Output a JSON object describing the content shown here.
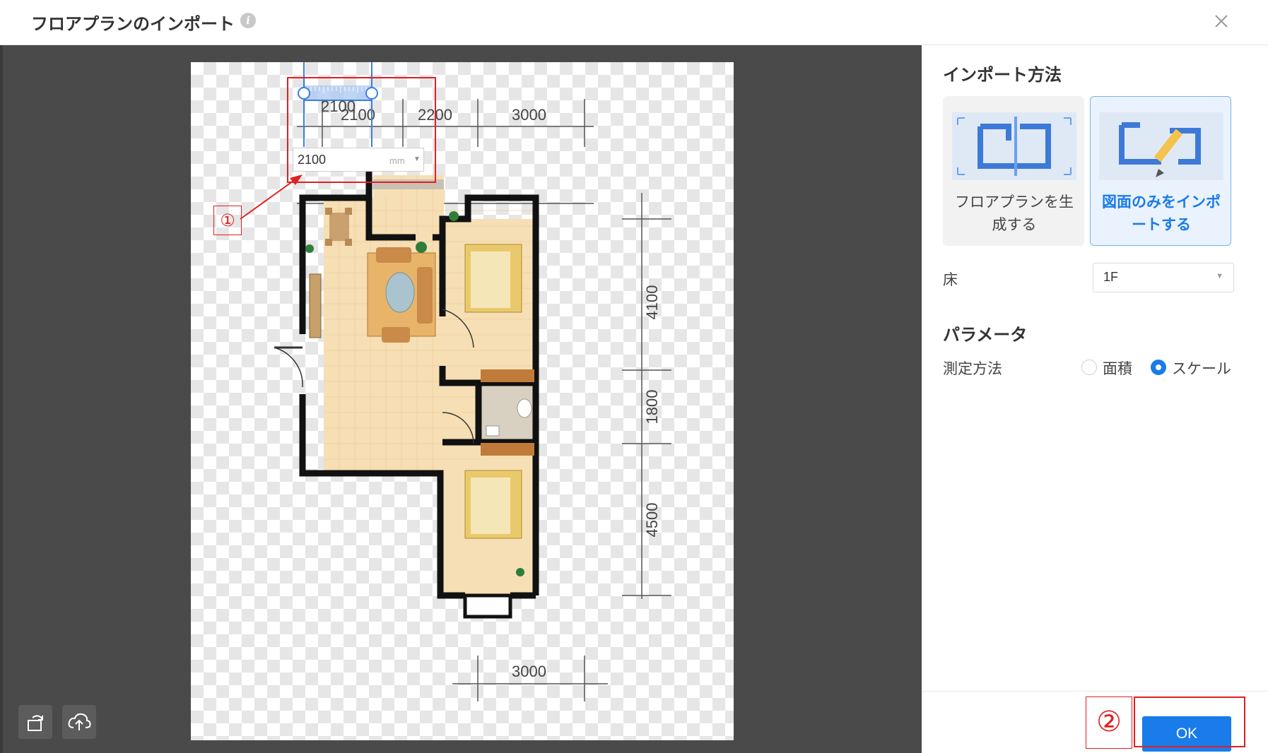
{
  "dialog": {
    "title": "フロアプランのインポート",
    "info_icon_glyph": "i",
    "close_icon": "close-icon"
  },
  "canvas": {
    "tools": [
      {
        "name": "rotate-icon"
      },
      {
        "name": "upload-icon"
      }
    ],
    "dimensions": {
      "top": [
        "2100",
        "2200",
        "3000"
      ],
      "right": [
        "4100",
        "1800",
        "4500"
      ],
      "bottom": "3000"
    },
    "scale_input": {
      "value": "2100",
      "unit": "mm",
      "ruler_label": "2100"
    }
  },
  "annotations": {
    "marker_1": "①",
    "marker_2": "②",
    "color": "#e02020"
  },
  "panel": {
    "import_method_title": "インポート方法",
    "cards": [
      {
        "line1": "フロアプランを生",
        "line2": "成する",
        "selected": false
      },
      {
        "line1": "図面のみをインポ",
        "line2": "ートする",
        "selected": true
      }
    ],
    "floor_label": "床",
    "floor_value": "1F",
    "params_title": "パラメータ",
    "measure_label": "測定方法",
    "radio_area": "面積",
    "radio_scale": "スケール",
    "ok_label": "OK"
  },
  "colors": {
    "accent": "#1a7bea",
    "canvas_bg": "#4a4a4a",
    "wall": "#111111",
    "floor": "#f6dfb4"
  }
}
